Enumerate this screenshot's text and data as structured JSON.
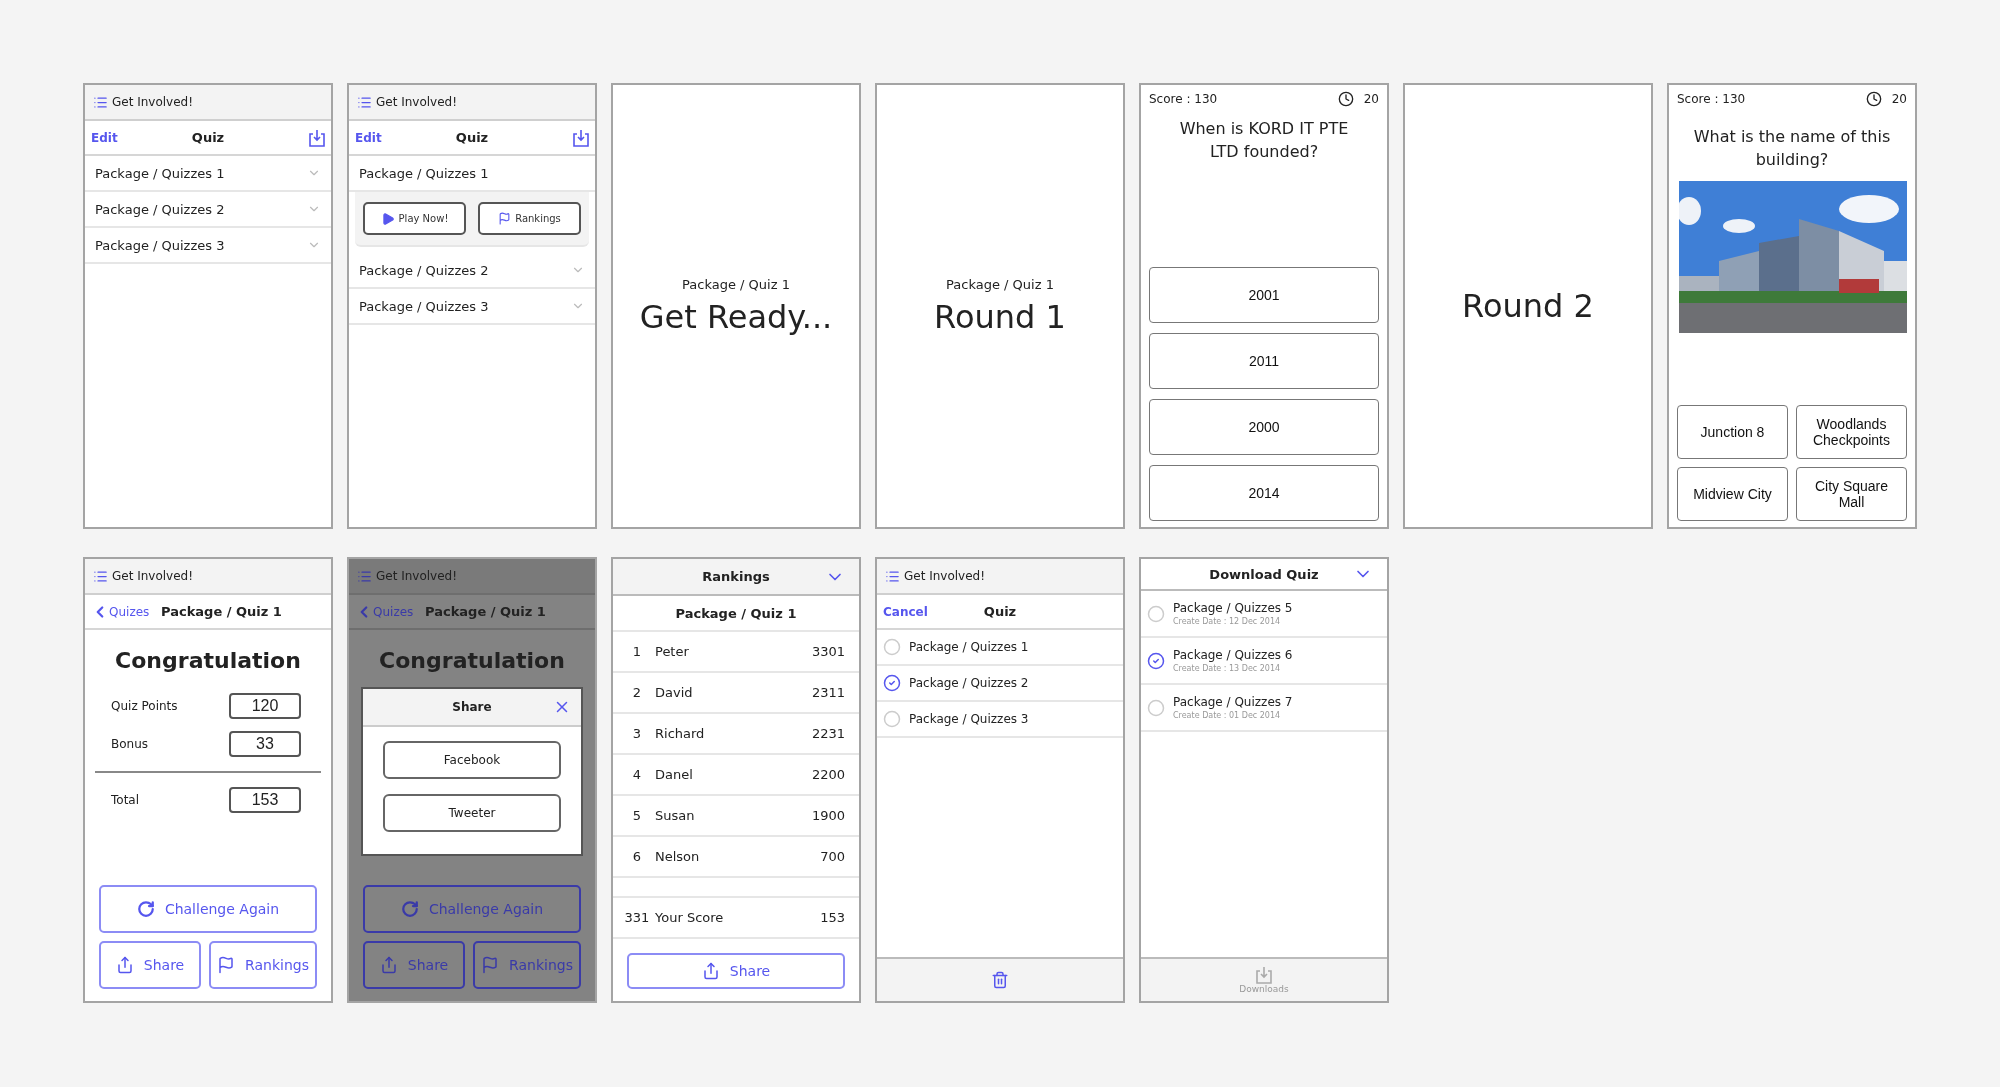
{
  "screens": [
    {
      "kind": "list",
      "app_title": "Get Involved!",
      "nav": {
        "left": "Edit",
        "title": "Quiz"
      },
      "items": [
        {
          "label": "Package / Quizzes 1",
          "expanded": false
        },
        {
          "label": "Package / Quizzes 2",
          "expanded": false
        },
        {
          "label": "Package / Quizzes 3",
          "expanded": false
        }
      ]
    },
    {
      "kind": "list",
      "app_title": "Get Involved!",
      "nav": {
        "left": "Edit",
        "title": "Quiz"
      },
      "items": [
        {
          "label": "Package / Quizzes 1",
          "expanded": true,
          "actions": [
            {
              "kind": "play",
              "label": "Play Now!"
            },
            {
              "kind": "flag",
              "label": "Rankings"
            }
          ]
        },
        {
          "label": "Package / Quizzes 2",
          "expanded": false
        },
        {
          "label": "Package / Quizzes 3",
          "expanded": false
        }
      ]
    },
    {
      "kind": "splash",
      "subtitle": "Package / Quiz 1",
      "heading": "Get Ready..."
    },
    {
      "kind": "splash",
      "subtitle": "Package / Quiz 1",
      "heading": "Round 1"
    },
    {
      "kind": "question",
      "score": "Score : 130",
      "timer": "20",
      "question": "When is KORD IT PTE LTD founded?",
      "answers": [
        "2001",
        "2011",
        "2000",
        "2014"
      ]
    },
    {
      "kind": "splash",
      "heading": "Round 2"
    },
    {
      "kind": "picture_question",
      "score": "Score : 130",
      "timer": "20",
      "question": "What is the name of this building?",
      "answers": [
        "Junction 8",
        "Woodlands Checkpoints",
        "Midview City",
        "City Square Mall"
      ]
    },
    {
      "kind": "result",
      "dimmed": false,
      "app_title": "Get Involved!",
      "nav": {
        "back": "Quizes",
        "title": "Package / Quiz 1"
      },
      "heading": "Congratulation",
      "scores": [
        {
          "label": "Quiz Points",
          "value": "120"
        },
        {
          "label": "Bonus",
          "value": "33"
        }
      ],
      "total": {
        "label": "Total",
        "value": "153"
      },
      "buttons": [
        {
          "kind": "retry",
          "label": "Challenge Again"
        },
        {
          "kind": "share",
          "label": "Share"
        },
        {
          "kind": "flag",
          "label": "Rankings"
        }
      ]
    },
    {
      "kind": "result",
      "dimmed": true,
      "app_title": "Get Involved!",
      "nav": {
        "back": "Quizes",
        "title": "Package / Quiz 1"
      },
      "heading": "Congratulation",
      "dialog": {
        "title": "Share",
        "options": [
          "Facebook",
          "Tweeter"
        ]
      },
      "buttons": [
        {
          "kind": "retry",
          "label": "Challenge Again"
        },
        {
          "kind": "share",
          "label": "Share"
        },
        {
          "kind": "flag",
          "label": "Rankings"
        }
      ]
    },
    {
      "kind": "rankings",
      "title": "Rankings",
      "subtitle": "Package / Quiz 1",
      "rows": [
        {
          "rank": "1",
          "name": "Peter",
          "score": "3301"
        },
        {
          "rank": "2",
          "name": "David",
          "score": "2311"
        },
        {
          "rank": "3",
          "name": "Richard",
          "score": "2231"
        },
        {
          "rank": "4",
          "name": "Danel",
          "score": "2200"
        },
        {
          "rank": "5",
          "name": "Susan",
          "score": "1900"
        },
        {
          "rank": "6",
          "name": "Nelson",
          "score": "700"
        }
      ],
      "own": {
        "rank": "331",
        "name": "Your Score",
        "score": "153"
      },
      "button": {
        "kind": "share",
        "label": "Share"
      }
    },
    {
      "kind": "select",
      "app_title": "Get Involved!",
      "nav": {
        "left": "Cancel",
        "title": "Quiz"
      },
      "items": [
        {
          "label": "Package / Quizzes 1",
          "selected": false
        },
        {
          "label": "Package / Quizzes 2",
          "selected": true
        },
        {
          "label": "Package / Quizzes 3",
          "selected": false
        }
      ]
    },
    {
      "kind": "download",
      "title": "Download Quiz",
      "items": [
        {
          "label": "Package / Quizzes 5",
          "date": "Create Date : 12 Dec 2014",
          "selected": false
        },
        {
          "label": "Package / Quizzes 6",
          "date": "Create Date : 13 Dec 2014",
          "selected": true
        },
        {
          "label": "Package / Quizzes 7",
          "date": "Create Date : 01 Dec 2014",
          "selected": false
        }
      ],
      "footer": "Downloads"
    }
  ]
}
